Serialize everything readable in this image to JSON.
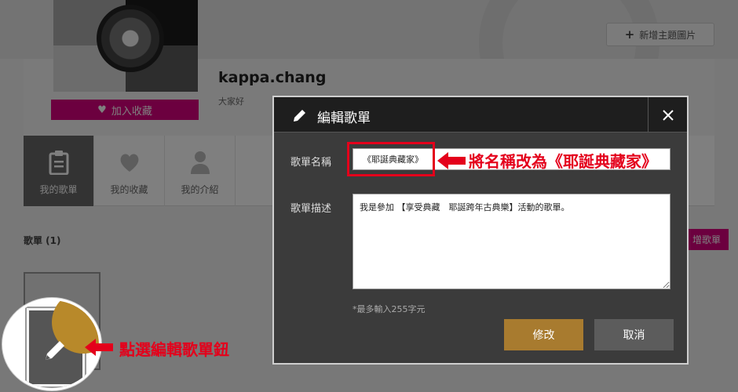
{
  "header": {
    "add_theme_label": "新增主題圖片",
    "username": "kappa.chang",
    "greeting": "大家好",
    "favorite_label": "加入收藏"
  },
  "tabs": [
    {
      "label": "我的歌單",
      "icon": "clipboard-icon",
      "active": true
    },
    {
      "label": "我的收藏",
      "icon": "heart-icon",
      "active": false
    },
    {
      "label": "我的介紹",
      "icon": "person-icon",
      "active": false
    }
  ],
  "playlists": {
    "section_title": "歌單 (1)",
    "add_button_label": "增歌單"
  },
  "modal": {
    "title": "編輯歌單",
    "name_label": "歌單名稱",
    "name_value": "《耶誕典藏家》",
    "desc_label": "歌單描述",
    "desc_value": "我是參加 【享受典藏　耶誕跨年古典樂】活動的歌單。",
    "limit_note": "*最多輸入255字元",
    "confirm_label": "修改",
    "cancel_label": "取消"
  },
  "annotations": {
    "rename_note": "將名稱改為《耶誕典藏家》",
    "edit_note": "點選編輯歌單鈕"
  },
  "colors": {
    "accent_pink": "#d9007e",
    "confirm_gold": "#a87b2f",
    "annotation_red": "#e4001b",
    "modal_bg": "#3b3b3b"
  }
}
